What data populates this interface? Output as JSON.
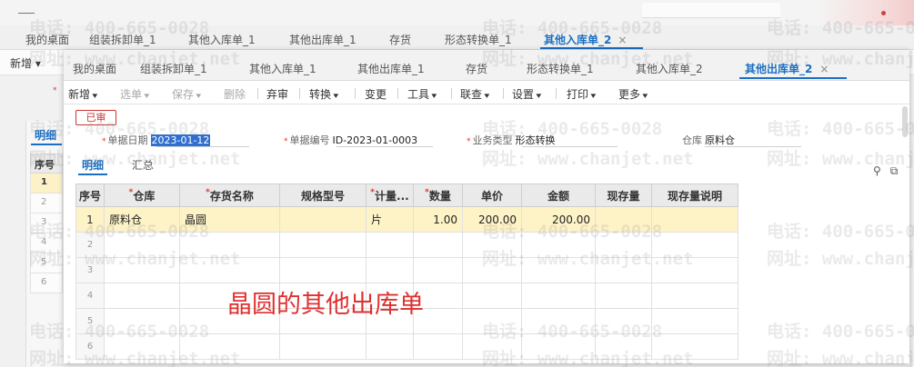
{
  "outer": {
    "tabs": [
      "我的桌面",
      "组装拆卸单_1",
      "其他入库单_1",
      "其他出库单_1",
      "存货",
      "形态转换单_1"
    ],
    "active_tab": "其他入库单_2",
    "close_glyph": "×",
    "toolbar_new": "新增",
    "required_mark": "*",
    "left_panel": {
      "tab": "明细",
      "header": "序号",
      "rows": [
        "1",
        "2",
        "3",
        "4",
        "5",
        "6"
      ]
    }
  },
  "window": {
    "tabs": [
      "我的桌面",
      "组装拆卸单_1",
      "其他入库单_1",
      "其他出库单_1",
      "存货",
      "形态转换单_1",
      "其他入库单_2"
    ],
    "active_tab": "其他出库单_2",
    "close_glyph": "×"
  },
  "toolbar": {
    "new": "新增",
    "select": "选单",
    "save": "保存",
    "delete": "删除",
    "abandon_review": "弃审",
    "convert": "转换",
    "change": "变更",
    "tools": "工具",
    "query": "联查",
    "settings": "设置",
    "print": "打印",
    "more": "更多"
  },
  "status_badge": "已审",
  "header_fields": {
    "date": {
      "label": "单据日期",
      "value": "2023-01-12"
    },
    "code": {
      "label": "单据编号",
      "value": "ID-2023-01-0003"
    },
    "business_type": {
      "label": "业务类型",
      "value": "形态转换"
    },
    "warehouse": {
      "label": "仓库",
      "value": "原料仓"
    }
  },
  "subtabs": {
    "detail": "明细",
    "summary": "汇总"
  },
  "grid": {
    "columns": [
      "序号",
      "仓库",
      "存货名称",
      "规格型号",
      "计量...",
      "数量",
      "单价",
      "金额",
      "现存量",
      "现存量说明"
    ],
    "rows": [
      {
        "idx": "1",
        "warehouse": "原料仓",
        "item": "晶圆",
        "spec": "",
        "unit": "片",
        "qty": "1.00",
        "price": "200.00",
        "amount": "200.00",
        "stock": "",
        "stock_note": ""
      },
      {
        "idx": "2"
      },
      {
        "idx": "3"
      },
      {
        "idx": "4"
      },
      {
        "idx": "5"
      },
      {
        "idx": "6"
      }
    ]
  },
  "annotation": "晶圆的其他出库单",
  "watermark": {
    "phone": "电话: 400-665-0028",
    "site": "网址: www.chanjet.net"
  },
  "icons": [
    "location-icon",
    "copy-icon"
  ],
  "colors": {
    "accent": "#1b6fc2",
    "required": "#d33333",
    "selected_row": "#fdf3c7",
    "badge": "#cc3333"
  }
}
